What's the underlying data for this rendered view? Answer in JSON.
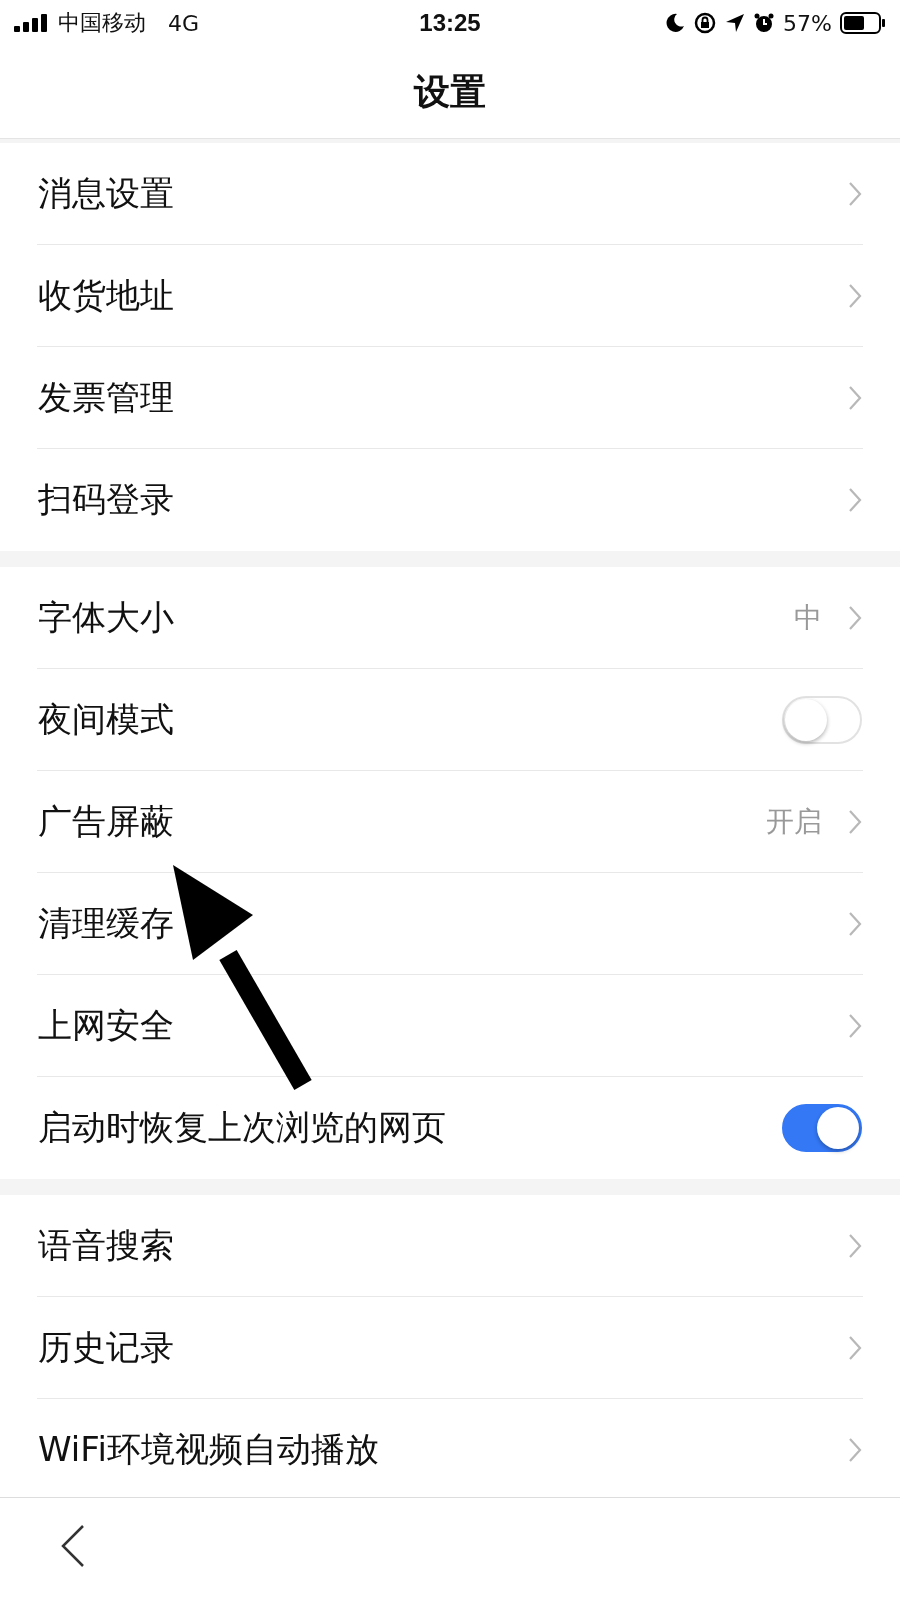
{
  "status_bar": {
    "carrier": "中国移动",
    "network": "4G",
    "time": "13:25",
    "battery": "57%"
  },
  "header": {
    "title": "设置"
  },
  "groups": [
    {
      "rows": [
        {
          "kind": "link",
          "label": "消息设置"
        },
        {
          "kind": "link",
          "label": "收货地址"
        },
        {
          "kind": "link",
          "label": "发票管理"
        },
        {
          "kind": "link",
          "label": "扫码登录"
        }
      ]
    },
    {
      "rows": [
        {
          "kind": "value",
          "label": "字体大小",
          "value": "中"
        },
        {
          "kind": "toggle",
          "label": "夜间模式",
          "on": false
        },
        {
          "kind": "value",
          "label": "广告屏蔽",
          "value": "开启"
        },
        {
          "kind": "link",
          "label": "清理缓存"
        },
        {
          "kind": "link",
          "label": "上网安全"
        },
        {
          "kind": "toggle",
          "label": "启动时恢复上次浏览的网页",
          "on": true
        }
      ]
    },
    {
      "rows": [
        {
          "kind": "link",
          "label": "语音搜索"
        },
        {
          "kind": "link",
          "label": "历史记录"
        },
        {
          "kind": "link",
          "label": "WiFi环境视频自动播放"
        }
      ]
    }
  ]
}
